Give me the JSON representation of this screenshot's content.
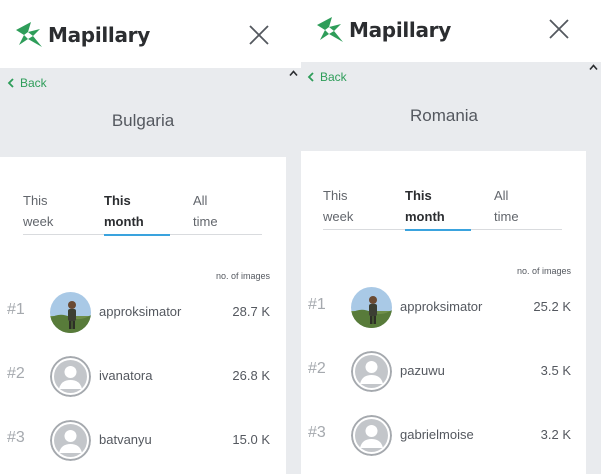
{
  "app": {
    "logo_text": "Mapillary",
    "brand_color": "#2e9d59",
    "accent_color": "#3aa3de"
  },
  "panels": [
    {
      "back_label": "Back",
      "country": "Bulgaria",
      "tabs": [
        {
          "line1": "This",
          "line2": "week",
          "active": false
        },
        {
          "line1": "This",
          "line2": "month",
          "active": true
        },
        {
          "line1": "All",
          "line2": "time",
          "active": false
        }
      ],
      "column_header": "no. of images",
      "rows": [
        {
          "rank": "#1",
          "username": "approksimator",
          "count": "28.7 K",
          "avatar": "photo"
        },
        {
          "rank": "#2",
          "username": "ivanatora",
          "count": "26.8 K",
          "avatar": "default-avatar-icon"
        },
        {
          "rank": "#3",
          "username": "batvanyu",
          "count": "15.0 K",
          "avatar": "default-avatar-icon"
        }
      ]
    },
    {
      "back_label": "Back",
      "country": "Romania",
      "tabs": [
        {
          "line1": "This",
          "line2": "week",
          "active": false
        },
        {
          "line1": "This",
          "line2": "month",
          "active": true
        },
        {
          "line1": "All",
          "line2": "time",
          "active": false
        }
      ],
      "column_header": "no. of images",
      "rows": [
        {
          "rank": "#1",
          "username": "approksimator",
          "count": "25.2 K",
          "avatar": "photo"
        },
        {
          "rank": "#2",
          "username": "pazuwu",
          "count": "3.5 K",
          "avatar": "default-avatar-icon"
        },
        {
          "rank": "#3",
          "username": "gabrielmoise",
          "count": "3.2 K",
          "avatar": "default-avatar-icon"
        }
      ]
    }
  ]
}
